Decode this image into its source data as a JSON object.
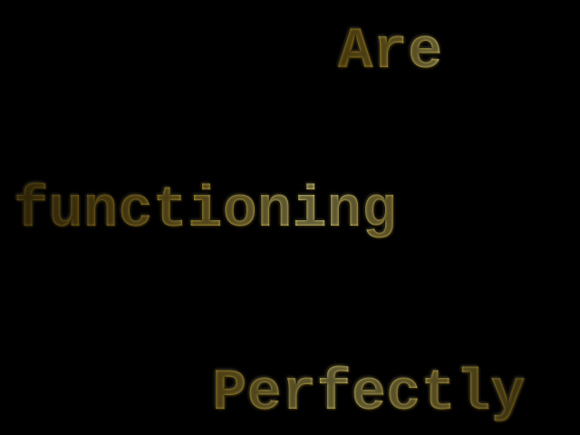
{
  "words": {
    "first": "Are",
    "second": "functioning",
    "third": "Perfectly"
  },
  "colors": {
    "background": "#000000",
    "text_gold": "#cdb040",
    "text_highlight": "#f2e688",
    "text_shadow": "#6e5514"
  }
}
